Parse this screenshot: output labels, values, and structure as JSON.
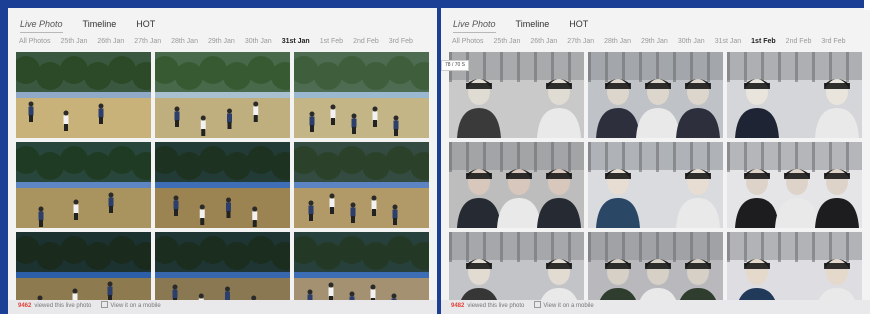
{
  "left": {
    "tabs": [
      "Live Photo",
      "Timeline",
      "HOT"
    ],
    "dates": [
      "All Photos",
      "25th Jan",
      "26th Jan",
      "27th Jan",
      "28th Jan",
      "29th Jan",
      "30th Jan",
      "31st Jan",
      "1st Feb",
      "2nd Feb",
      "3rd Feb"
    ],
    "active_date": "31st Jan",
    "footer": {
      "count": "9462",
      "viewed": "viewed this live photo",
      "mobile": "View it on a mobile"
    },
    "photos": [
      {
        "scene": "sports-day",
        "colors": [
          "#8fa9c7",
          "#2c4a27",
          "#c9b27a"
        ]
      },
      {
        "scene": "sports-day",
        "colors": [
          "#a9c0d0",
          "#385a33",
          "#bfae7e"
        ]
      },
      {
        "scene": "sports-day",
        "colors": [
          "#9ab8cf",
          "#3f5e3b",
          "#c4b587"
        ]
      },
      {
        "scene": "sports-dusk",
        "colors": [
          "#5e86c4",
          "#1f3b23",
          "#a9945f"
        ]
      },
      {
        "scene": "sports-dusk",
        "colors": [
          "#3e6fb6",
          "#1d3220",
          "#9c8452"
        ]
      },
      {
        "scene": "sports-dusk",
        "colors": [
          "#5c84c2",
          "#2b4129",
          "#b19a68"
        ]
      },
      {
        "scene": "sports-dusk",
        "colors": [
          "#2d5fa8",
          "#1a2a1c",
          "#8e7a4f"
        ]
      },
      {
        "scene": "sports-dusk",
        "colors": [
          "#3967ad",
          "#1b2d1e",
          "#8a7853"
        ]
      },
      {
        "scene": "sports-dusk",
        "colors": [
          "#3d6eb5",
          "#243826",
          "#a39172"
        ]
      }
    ]
  },
  "right": {
    "tabs": [
      "Live Photo",
      "Timeline",
      "HOT"
    ],
    "dates": [
      "All Photos",
      "25th Jan",
      "26th Jan",
      "27th Jan",
      "28th Jan",
      "29th Jan",
      "30th Jan",
      "31st Jan",
      "1st Feb",
      "2nd Feb",
      "3rd Feb"
    ],
    "active_date": "1st Feb",
    "footer": {
      "count": "9482",
      "viewed": "viewed this live photo",
      "mobile": "View it on a mobile"
    },
    "tooltip": "78 / 70 S",
    "photos": [
      {
        "scene": "indoor-group",
        "colors": [
          "#c9c9c9",
          "#3a3a3a",
          "#e0dcd4"
        ]
      },
      {
        "scene": "indoor-group",
        "colors": [
          "#bfc2c6",
          "#2d2f3d",
          "#dcd6cc"
        ]
      },
      {
        "scene": "indoor-group",
        "colors": [
          "#d4d6da",
          "#1e2433",
          "#e9e5dd"
        ]
      },
      {
        "scene": "indoor-selfie",
        "colors": [
          "#bdbdbd",
          "#262a33",
          "#d7c7bc"
        ]
      },
      {
        "scene": "indoor-selfie",
        "colors": [
          "#d9dbdf",
          "#2a4766",
          "#e7ddd2"
        ]
      },
      {
        "scene": "indoor-event",
        "colors": [
          "#e5e5e8",
          "#1d1d1f",
          "#ddd3c9"
        ]
      },
      {
        "scene": "indoor-group",
        "colors": [
          "#c3c4c7",
          "#363636",
          "#e1dbd2"
        ]
      },
      {
        "scene": "indoor-group",
        "colors": [
          "#b9b9bd",
          "#2e3d2e",
          "#d6d0c6"
        ]
      },
      {
        "scene": "indoor-event",
        "colors": [
          "#dedee2",
          "#223a5a",
          "#e4d9cb"
        ]
      }
    ]
  }
}
